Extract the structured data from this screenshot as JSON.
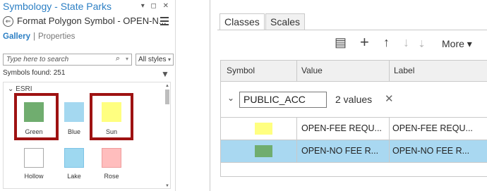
{
  "left_pane": {
    "title": "Symbology - State Parks",
    "window_controls": "▾ ◻ ✕",
    "back_glyph": "⇐",
    "subtitle": "Format Polygon Symbol - OPEN-N...",
    "tabs": {
      "gallery": "Gallery",
      "separator": "|",
      "properties": "Properties"
    },
    "search": {
      "placeholder": "Type here to search",
      "icon": "⌕",
      "chevron": "▾"
    },
    "style_filter": {
      "value": "All styles",
      "chevron": "▾"
    },
    "symbols_found": "Symbols found: 251",
    "filter_icon": "▼",
    "group_header": "⌄ ESRI",
    "scroll": {
      "up": "▲",
      "down": "▼"
    },
    "symbols": [
      {
        "label": "Green",
        "color": "#70ad6f",
        "border": "#70ad6f",
        "highlighted": true
      },
      {
        "label": "Blue",
        "color": "#a4d8f0",
        "border": "#a4d8f0",
        "highlighted": false
      },
      {
        "label": "Sun",
        "color": "#ffff80",
        "border": "#ffff80",
        "highlighted": true
      },
      {
        "label": "Hollow",
        "color": "#ffffff",
        "border": "#aaaaaa",
        "highlighted": false
      },
      {
        "label": "Lake",
        "color": "#9ed8f0",
        "border": "#7cc3e6",
        "highlighted": false
      },
      {
        "label": "Rose",
        "color": "#ffbdbd",
        "border": "#ee9d9d",
        "highlighted": false
      }
    ],
    "highlight_color": "#9e1212",
    "accent_color": "#2c7fc4"
  },
  "right_pane": {
    "tabs": {
      "classes": "Classes",
      "scales": "Scales"
    },
    "toolbar": {
      "add_from_file_icon": "▤",
      "add_icon": "+",
      "move_up_icon": "↑",
      "move_down_icon": "↓",
      "more_options_icon": "⇣",
      "more_label": "More ▾"
    },
    "columns": {
      "symbol": "Symbol",
      "value": "Value",
      "label": "Label"
    },
    "group": {
      "chevron": "⌄",
      "field": "PUBLIC_ACC",
      "count": "2 values",
      "remove_icon": "✕"
    },
    "rows": [
      {
        "swatch": "#ffff80",
        "value": "OPEN-FEE REQU...",
        "label": "OPEN-FEE REQU...",
        "selected": false
      },
      {
        "swatch": "#70ad6f",
        "value": "OPEN-NO FEE R...",
        "label": "OPEN-NO FEE R...",
        "selected": true
      }
    ],
    "selection_color": "#a9d8f1"
  }
}
